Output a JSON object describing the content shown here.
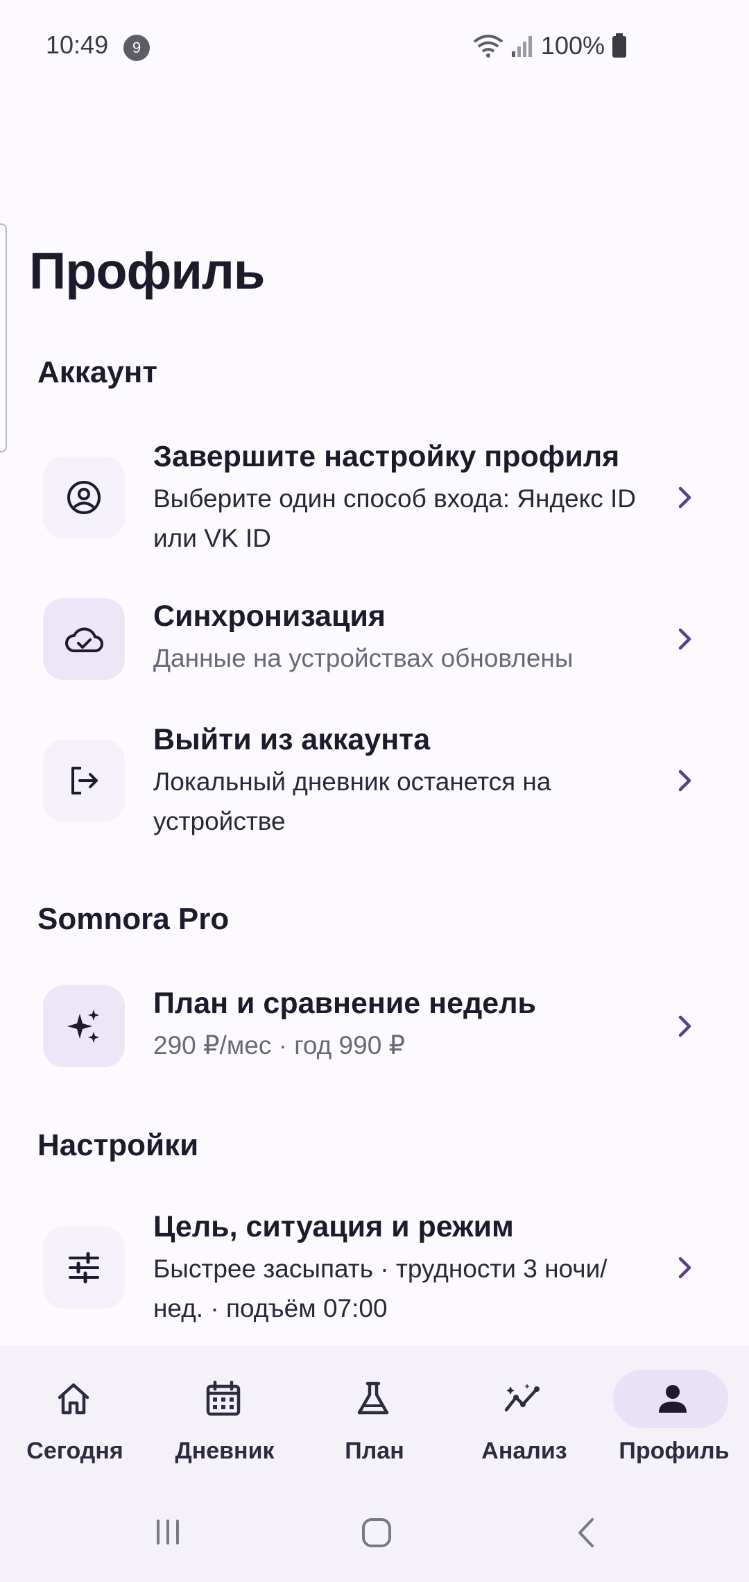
{
  "status_bar": {
    "time": "10:49",
    "notification_count": "9",
    "battery": "100%"
  },
  "page": {
    "title": "Профиль"
  },
  "sections": {
    "account": {
      "title": "Аккаунт",
      "items": [
        {
          "title": "Завершите настройку профиля",
          "subtitle": "Выберите один способ входа: Яндекс ID или VK ID",
          "icon": "user-circle-icon"
        },
        {
          "title": "Синхронизация",
          "subtitle": "Данные на устройствах обновлены",
          "icon": "cloud-check-icon"
        },
        {
          "title": "Выйти из аккаунта",
          "subtitle": "Локальный дневник останется на устройстве",
          "icon": "logout-icon"
        }
      ]
    },
    "pro": {
      "title": "Somnora Pro",
      "items": [
        {
          "title": "План и сравнение недель",
          "subtitle": "290 ₽/мес · год 990 ₽",
          "icon": "sparkles-icon"
        }
      ]
    },
    "settings": {
      "title": "Настройки",
      "items": [
        {
          "title": "Цель, ситуация и режим",
          "subtitle": "Быстрее засыпать · трудности 3 ночи/нед. · подъём 07:00",
          "icon": "sliders-icon"
        }
      ]
    }
  },
  "bottom_nav": {
    "items": [
      {
        "label": "Сегодня",
        "icon": "home-icon"
      },
      {
        "label": "Дневник",
        "icon": "calendar-icon"
      },
      {
        "label": "План",
        "icon": "flask-icon"
      },
      {
        "label": "Анализ",
        "icon": "analytics-icon"
      },
      {
        "label": "Профиль",
        "icon": "person-icon",
        "active": true
      }
    ]
  },
  "colors": {
    "background": "#fcfaff",
    "accent": "#5a3f8c",
    "active_pill": "#e9e1f6",
    "icon_tile": "#f4f1fa",
    "icon_tile_tinted": "#ece6f7"
  }
}
